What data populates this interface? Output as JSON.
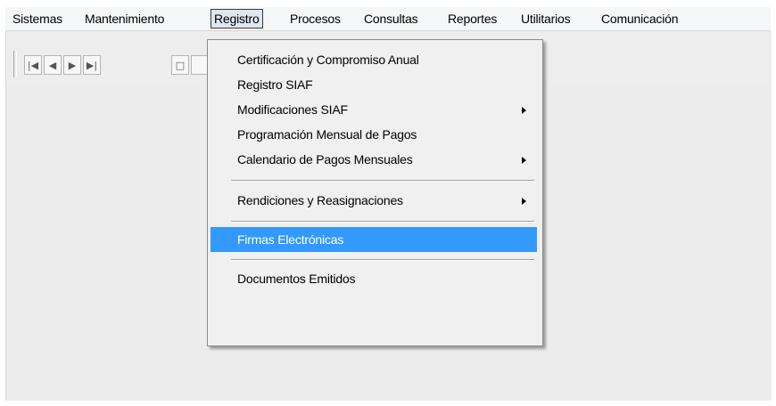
{
  "menubar": {
    "items": [
      "Sistemas",
      "Mantenimiento",
      "Registro",
      "Procesos",
      "Consultas",
      "Reportes",
      "Utilitarios",
      "Comunicación"
    ],
    "active": "Registro"
  },
  "toolbar": {
    "buttons": [
      {
        "name": "first-record-icon",
        "glyph": "|◀"
      },
      {
        "name": "previous-record-icon",
        "glyph": "◀"
      },
      {
        "name": "next-record-icon",
        "glyph": "▶"
      },
      {
        "name": "last-record-icon",
        "glyph": "▶|"
      },
      {
        "name": "new-document-icon",
        "glyph": "□"
      }
    ]
  },
  "dropdown": {
    "items": [
      {
        "label": "Certificación y Compromiso Anual",
        "submenu": false
      },
      {
        "label": "Registro SIAF",
        "submenu": false
      },
      {
        "label": "Modificaciones SIAF",
        "submenu": true
      },
      {
        "label": "Programación Mensual de Pagos",
        "submenu": false
      },
      {
        "label": "Calendario de Pagos Mensuales",
        "submenu": true
      },
      {
        "label": "Rendiciones y Reasignaciones",
        "submenu": true
      },
      {
        "label": "Firmas Electrónicas",
        "submenu": false,
        "highlighted": true
      },
      {
        "label": "Documentos Emitidos",
        "submenu": false
      }
    ]
  },
  "colors": {
    "highlight": "#3399ff",
    "menubar_bg": "#f5f6f7",
    "workspace_bg": "#ececec"
  }
}
